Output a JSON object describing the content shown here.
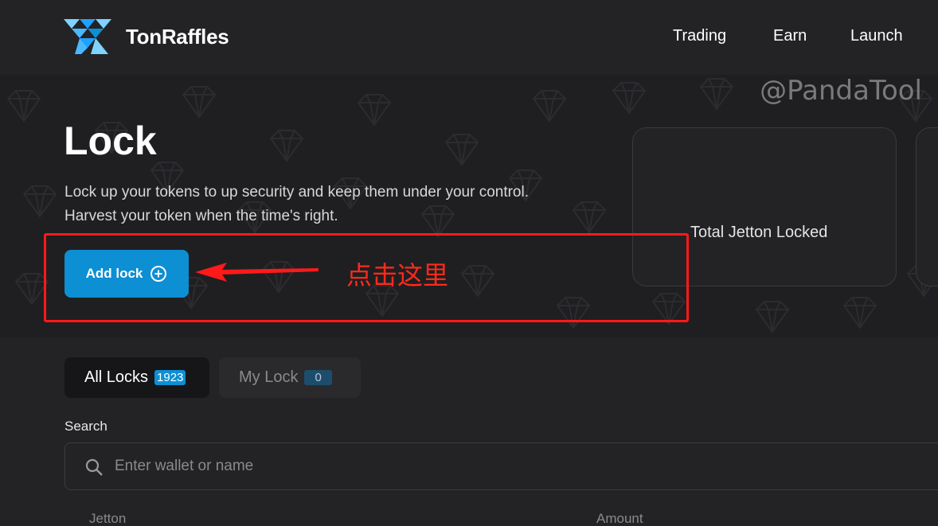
{
  "app": {
    "name": "TonRaffles"
  },
  "nav": {
    "items": [
      "Trading",
      "Earn",
      "Launch"
    ]
  },
  "watermark": "@PandaTool",
  "hero": {
    "title": "Lock",
    "description_line1": "Lock up your tokens to up security and keep them under your control.",
    "description_line2": "Harvest your token when the time's right.",
    "add_lock_label": "Add lock",
    "stat_label": "Total Jetton Locked"
  },
  "annotation": {
    "text": "点击这里",
    "color": "#ff1a1a"
  },
  "tabs": [
    {
      "label": "All Locks",
      "count": "1923"
    },
    {
      "label": "My Lock",
      "count": "0"
    }
  ],
  "search": {
    "label": "Search",
    "placeholder": "Enter wallet or name",
    "value": ""
  },
  "table": {
    "columns": [
      "Jetton",
      "Amount"
    ]
  },
  "colors": {
    "accent": "#0d8fd4",
    "background": "#232326",
    "hero_background": "#1f1f21"
  }
}
